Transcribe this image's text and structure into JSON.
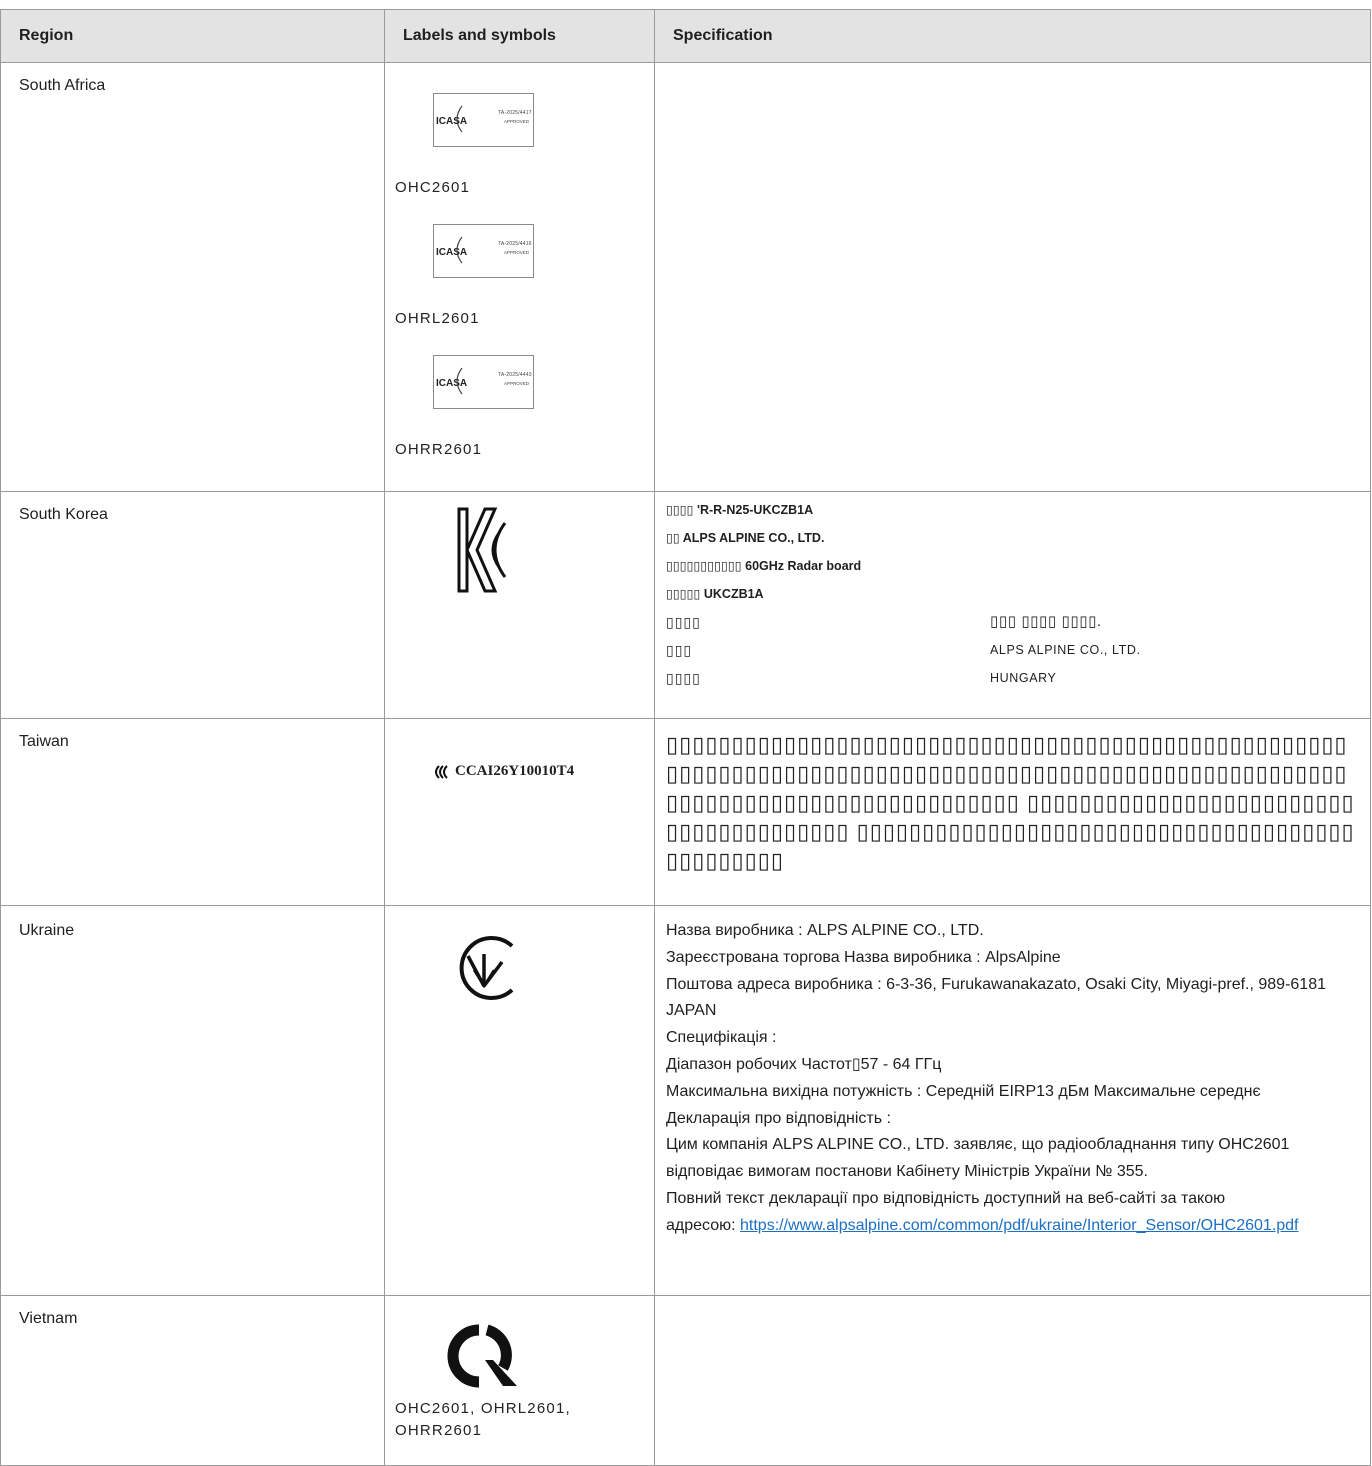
{
  "header": {
    "region": "Region",
    "labels": "Labels and symbols",
    "spec": "Specification"
  },
  "south_africa": {
    "region": "South Africa",
    "labels": [
      {
        "code": "TA-2025/4417",
        "approved": "APPROVED",
        "model": "OHC2601"
      },
      {
        "code": "TA-2025/4416",
        "approved": "APPROVED",
        "model": "OHRL2601"
      },
      {
        "code": "TA-2025/4443",
        "approved": "APPROVED",
        "model": "OHRR2601"
      }
    ],
    "icasa_text": "ICASA"
  },
  "south_korea": {
    "region": "South Korea",
    "lines": [
      "▯▯▯▯ 'R-R-N25-UKCZB1A",
      "▯▯ ALPS ALPINE CO., LTD.",
      "▯▯▯▯▯▯▯▯▯▯▯ 60GHz Radar board",
      "▯▯▯▯▯ UKCZB1A"
    ],
    "table": [
      {
        "key": "▯▯▯▯",
        "value": "▯▯▯ ▯▯▯▯ ▯▯▯▯."
      },
      {
        "key": "▯▯▯",
        "value": "ALPS ALPINE CO., LTD."
      },
      {
        "key": "▯▯▯▯",
        "value": "HUNGARY"
      }
    ]
  },
  "taiwan": {
    "region": "Taiwan",
    "ncc_code": "CCAI26Y10010T4",
    "text": "▯▯▯▯▯▯▯▯▯▯▯▯▯▯▯▯▯▯▯▯▯▯▯▯▯▯▯▯▯▯▯▯▯▯▯▯▯▯▯▯▯▯▯▯▯▯▯▯▯▯▯▯▯▯▯▯▯▯▯▯▯▯▯▯▯▯▯▯▯▯▯▯▯▯▯▯▯▯▯▯▯▯▯▯▯▯▯▯▯▯▯▯▯▯▯▯▯▯▯▯▯▯▯▯▯▯▯▯▯▯▯▯▯▯▯▯▯▯▯▯▯▯▯▯▯▯▯▯▯▯▯ ▯▯▯▯▯▯▯▯▯▯▯▯▯▯▯▯▯▯▯▯▯▯▯▯▯▯▯▯▯▯▯▯▯▯▯▯▯▯▯ ▯▯▯▯▯▯▯▯▯▯▯▯▯▯▯▯▯▯▯▯▯▯▯▯▯▯▯▯▯▯▯▯▯▯▯▯▯▯▯▯▯▯▯▯▯▯▯"
  },
  "ukraine": {
    "region": "Ukraine",
    "lines": [
      "Назва виробника : ALPS ALPINE CO., LTD.",
      "Зареєстрована торгова Назва виробника : AlpsAlpine",
      "Поштова адреса виробника : 6-3-36, Furukawanakazato, Osaki City, Miyagi-pref., 989-6181 JAPAN",
      "Специфікація :",
      "Діапазон робочих Частот▯57 - 64 ГГц",
      "Максимальна вихідна потужність : Середній EIRP13 дБм Максимальне середнє",
      "Декларація про відповідність :",
      "Цим компанія ALPS ALPINE CO., LTD. заявляє, що радіообладнання типу OHC2601 відповідає вимогам постанови Кабінету Міністрів України № 355.",
      "Повний текст декларації про відповідність доступний на веб-сайті за такою"
    ],
    "link_prefix": "адресою: ",
    "link": "https://www.alpsalpine.com/common/pdf/ukraine/Interior_Sensor/OHC2601.pdf"
  },
  "vietnam": {
    "region": "Vietnam",
    "models": "OHC2601, OHRL2601, OHRR2601"
  }
}
